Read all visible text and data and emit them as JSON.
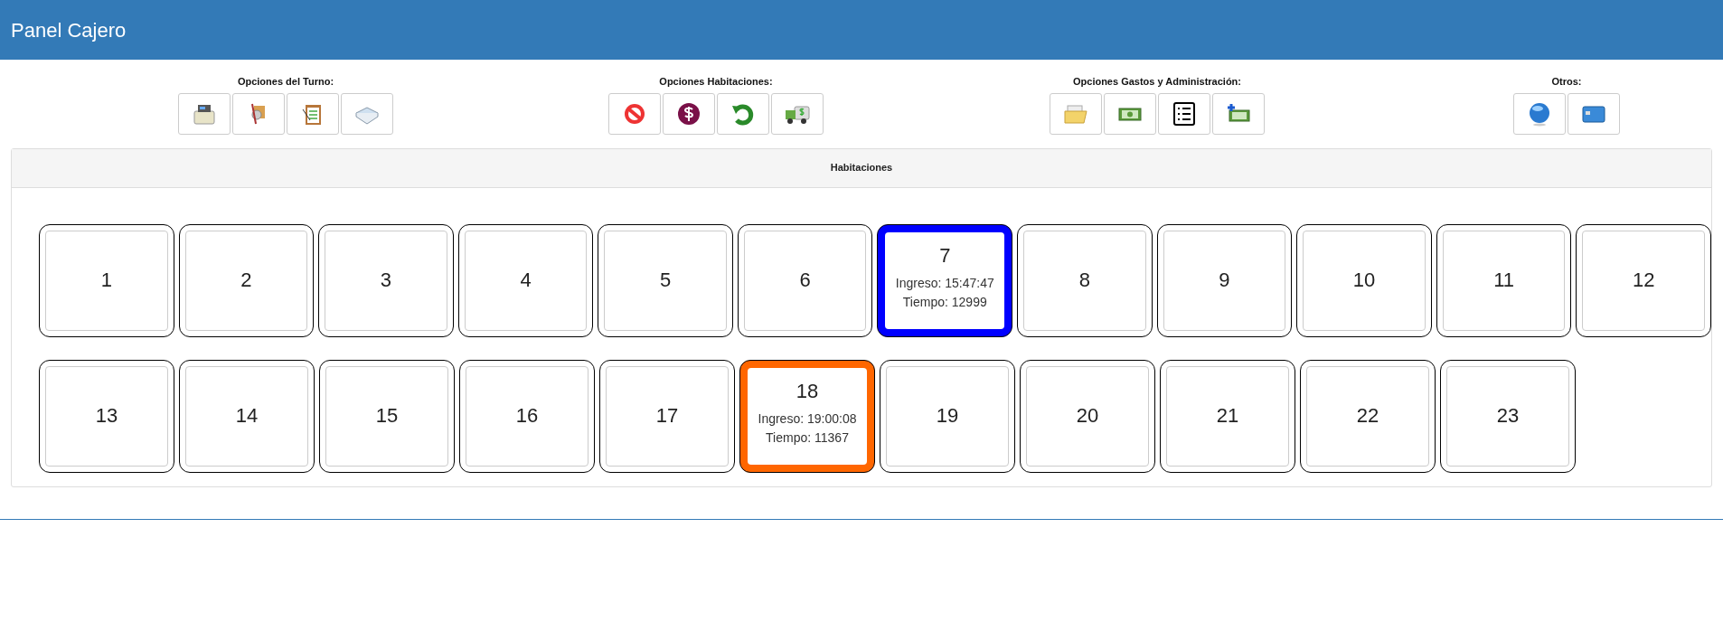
{
  "header": {
    "title": "Panel Cajero"
  },
  "toolbar": [
    {
      "label": "Opciones del Turno:"
    },
    {
      "label": "Opciones Habitaciones:"
    },
    {
      "label": "Opciones Gastos y Administración:"
    },
    {
      "label": "Otros:"
    }
  ],
  "panel": {
    "title": "Habitaciones",
    "rooms": [
      {
        "number": "1"
      },
      {
        "number": "2"
      },
      {
        "number": "3"
      },
      {
        "number": "4"
      },
      {
        "number": "5"
      },
      {
        "number": "6"
      },
      {
        "number": "7",
        "color": "#0000ff",
        "ingreso": "Ingreso: 15:47:47",
        "tiempo": "Tiempo: 12999"
      },
      {
        "number": "8"
      },
      {
        "number": "9"
      },
      {
        "number": "10"
      },
      {
        "number": "11"
      },
      {
        "number": "12"
      },
      {
        "number": "13"
      },
      {
        "number": "14"
      },
      {
        "number": "15"
      },
      {
        "number": "16"
      },
      {
        "number": "17"
      },
      {
        "number": "18",
        "color": "#ff6600",
        "ingreso": "Ingreso: 19:00:08",
        "tiempo": "Tiempo: 11367"
      },
      {
        "number": "19"
      },
      {
        "number": "20"
      },
      {
        "number": "21"
      },
      {
        "number": "22"
      },
      {
        "number": "23"
      }
    ]
  }
}
